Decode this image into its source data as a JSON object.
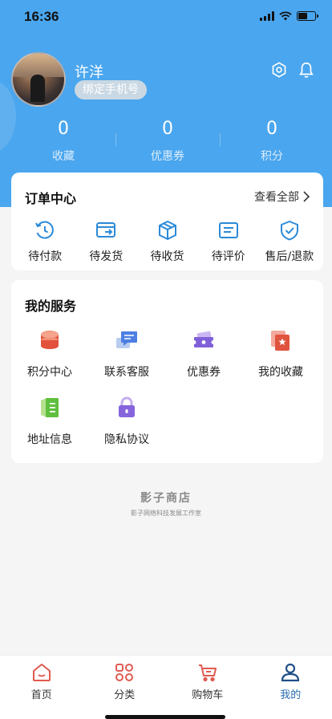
{
  "status_bar": {
    "time": "16:36"
  },
  "profile": {
    "username": "许洋",
    "bind_phone_label": "绑定手机号"
  },
  "stats": [
    {
      "value": "0",
      "label": "收藏"
    },
    {
      "value": "0",
      "label": "优惠券"
    },
    {
      "value": "0",
      "label": "积分"
    }
  ],
  "orders": {
    "title": "订单中心",
    "view_all": "查看全部",
    "items": [
      {
        "label": "待付款",
        "icon": "clock-history-icon"
      },
      {
        "label": "待发货",
        "icon": "card-transfer-icon"
      },
      {
        "label": "待收货",
        "icon": "package-box-icon"
      },
      {
        "label": "待评价",
        "icon": "review-list-icon"
      },
      {
        "label": "售后/退款",
        "icon": "shield-check-icon"
      }
    ]
  },
  "services": {
    "title": "我的服务",
    "items": [
      {
        "label": "积分中心",
        "icon": "coins-stack-icon"
      },
      {
        "label": "联系客服",
        "icon": "chat-bubbles-icon"
      },
      {
        "label": "优惠券",
        "icon": "ticket-icon"
      },
      {
        "label": "我的收藏",
        "icon": "favorites-star-icon"
      },
      {
        "label": "地址信息",
        "icon": "address-book-icon"
      },
      {
        "label": "隐私协议",
        "icon": "lock-icon"
      }
    ]
  },
  "brand": {
    "name": "影子商店",
    "subtitle": "影子网络科技发展工作室"
  },
  "tabbar": {
    "items": [
      {
        "label": "首页",
        "icon": "home-icon"
      },
      {
        "label": "分类",
        "icon": "category-icon"
      },
      {
        "label": "购物车",
        "icon": "cart-icon"
      },
      {
        "label": "我的",
        "icon": "profile-icon",
        "active": true
      }
    ]
  },
  "colors": {
    "header_blue": "#4aa6ee",
    "order_icon_blue": "#2b8ad8",
    "tab_red": "#e05a50",
    "tab_active": "#1f4f86"
  }
}
